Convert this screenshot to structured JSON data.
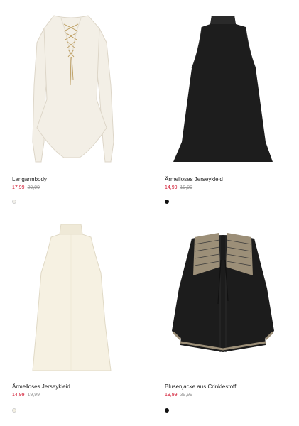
{
  "products": [
    {
      "name": "Langarmbody",
      "price": "17,99",
      "old_price": "29,99",
      "swatch_color": "#f2f0ea",
      "swatch_border": "#cfcfcf",
      "garment_color": "#f3efe6",
      "image_icon": "white-laceup-bodysuit"
    },
    {
      "name": "Ärmelloses Jerseykleid",
      "price": "14,99",
      "old_price": "19,99",
      "swatch_color": "#111111",
      "swatch_border": "#111111",
      "garment_color": "#1d1d1d",
      "image_icon": "black-sleeveless-dress"
    },
    {
      "name": "Ärmelloses Jerseykleid",
      "price": "14,99",
      "old_price": "19,99",
      "swatch_color": "#f4f0e2",
      "swatch_border": "#cfcfcf",
      "garment_color": "#f6f1e2",
      "image_icon": "cream-sleeveless-dress"
    },
    {
      "name": "Blusenjacke aus Crinklestoff",
      "price": "19,99",
      "old_price": "39,99",
      "swatch_color": "#111111",
      "swatch_border": "#111111",
      "garment_color": "#1c1c1c",
      "image_icon": "black-embroidered-blouse-jacket"
    }
  ]
}
